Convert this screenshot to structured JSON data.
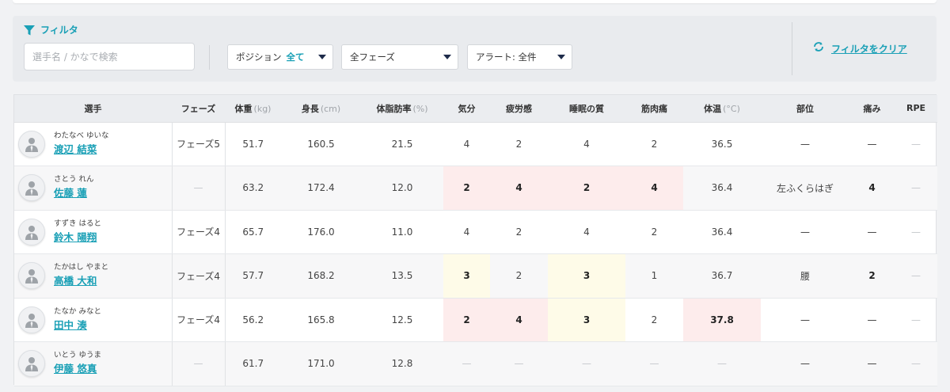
{
  "filter": {
    "title": "フィルタ",
    "search_placeholder": "選手名 / かなで検索",
    "position_label": "ポジション",
    "position_value": "全て",
    "phase_value": "全フェーズ",
    "alert_value": "アラート: 全件",
    "clear_label": "フィルタをクリア"
  },
  "colors": {
    "accent": "#1aa0b6",
    "alert_red": "#fdecec",
    "alert_yellow": "#fefbe8",
    "caret": "#1e2b4a"
  },
  "table": {
    "headers": {
      "player": "選手",
      "phase": "フェーズ",
      "weight": "体重",
      "weight_unit": "(kg)",
      "height": "身長",
      "height_unit": "(cm)",
      "bodyfat": "体脂肪率",
      "bodyfat_unit": "(%)",
      "mood": "気分",
      "fatigue": "疲労感",
      "sleep": "睡眠の質",
      "soreness": "筋肉痛",
      "temp": "体温",
      "temp_unit": "(°C)",
      "part": "部位",
      "pain": "痛み",
      "rpe": "RPE"
    },
    "rows": [
      {
        "kana": "わたなべ ゆいな",
        "name": "渡辺 結菜",
        "phase": "フェーズ5",
        "weight": "51.7",
        "height": "160.5",
        "bodyfat": "21.5",
        "mood": "4",
        "fatigue": "2",
        "sleep": "4",
        "soreness": "2",
        "temp": "36.5",
        "part": "—",
        "pain": "—",
        "rpe": "—"
      },
      {
        "kana": "さとう れん",
        "name": "佐藤 蓮",
        "phase": "—",
        "weight": "63.2",
        "height": "172.4",
        "bodyfat": "12.0",
        "mood": "2",
        "fatigue": "4",
        "sleep": "2",
        "soreness": "4",
        "temp": "36.4",
        "part": "左ふくらはぎ",
        "pain": "4",
        "rpe": "—"
      },
      {
        "kana": "すずき はると",
        "name": "鈴木 陽翔",
        "phase": "フェーズ4",
        "weight": "65.7",
        "height": "176.0",
        "bodyfat": "11.0",
        "mood": "4",
        "fatigue": "2",
        "sleep": "4",
        "soreness": "2",
        "temp": "36.4",
        "part": "—",
        "pain": "—",
        "rpe": "—"
      },
      {
        "kana": "たかはし やまと",
        "name": "高橋 大和",
        "phase": "フェーズ4",
        "weight": "57.7",
        "height": "168.2",
        "bodyfat": "13.5",
        "mood": "3",
        "fatigue": "2",
        "sleep": "3",
        "soreness": "1",
        "temp": "36.7",
        "part": "腰",
        "pain": "2",
        "rpe": "—"
      },
      {
        "kana": "たなか みなと",
        "name": "田中 湊",
        "phase": "フェーズ4",
        "weight": "56.2",
        "height": "165.8",
        "bodyfat": "12.5",
        "mood": "2",
        "fatigue": "4",
        "sleep": "3",
        "soreness": "2",
        "temp": "37.8",
        "part": "—",
        "pain": "—",
        "rpe": "—"
      },
      {
        "kana": "いとう ゆうま",
        "name": "伊藤 悠真",
        "phase": "—",
        "weight": "61.7",
        "height": "171.0",
        "bodyfat": "12.8",
        "mood": "—",
        "fatigue": "—",
        "sleep": "—",
        "soreness": "—",
        "temp": "—",
        "part": "—",
        "pain": "—",
        "rpe": "—"
      }
    ]
  }
}
